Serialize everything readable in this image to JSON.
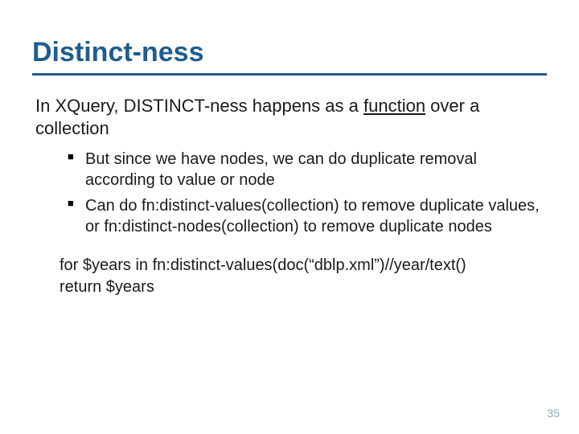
{
  "title": "Distinct-ness",
  "lead": {
    "prefix": "In XQuery, DISTINCT-ness happens as a ",
    "underlined": "function",
    "suffix": " over a collection"
  },
  "bullets": [
    "But since we have nodes, we can do duplicate removal according to value or node",
    "Can do fn:distinct-values(collection) to remove duplicate values, or fn:distinct-nodes(collection) to remove duplicate nodes"
  ],
  "code": [
    "for $years in fn:distinct-values(doc(“dblp.xml”)//year/text()",
    "return $years"
  ],
  "page_number": "35"
}
